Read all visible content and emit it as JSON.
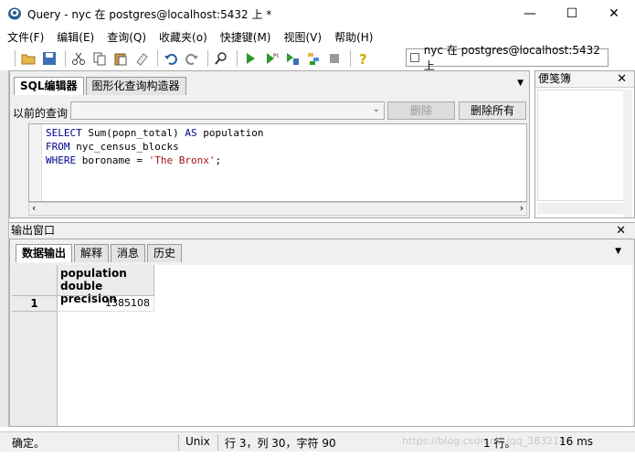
{
  "window": {
    "title": "Query - nyc 在  postgres@localhost:5432 上 *"
  },
  "window_buttons": {
    "minimize": "—",
    "maximize": "☐",
    "close": "✕"
  },
  "menu": [
    "文件(F)",
    "编辑(E)",
    "查询(Q)",
    "收藏夹(o)",
    "快捷键(M)",
    "视图(V)",
    "帮助(H)"
  ],
  "toolbar": {
    "connection": "nyc 在  postgres@localhost:5432 上"
  },
  "editor": {
    "tabs": [
      "SQL编辑器",
      "图形化查询构造器"
    ],
    "previous_label": "以前的查询",
    "delete_label": "删除",
    "delete_all_label": "删除所有",
    "code": {
      "line1": {
        "kw1": "SELECT",
        "t1": " Sum(popn_total) ",
        "kw2": "AS",
        "t2": " population"
      },
      "line2": {
        "kw1": "FROM",
        "t1": " nyc_census_blocks"
      },
      "line3": {
        "kw1": "WHERE",
        "t1": " boroname = ",
        "str": "'The Bronx'",
        "t2": ";"
      }
    }
  },
  "scratch": {
    "title": "便笺簿",
    "close": "✕"
  },
  "output": {
    "title": "输出窗口",
    "close": "✕",
    "tabs": [
      "数据输出",
      "解释",
      "消息",
      "历史"
    ],
    "column": {
      "name": "population",
      "type": "double precision"
    },
    "rows": [
      {
        "num": "1",
        "value": "1385108"
      }
    ]
  },
  "status": {
    "ready": "确定。",
    "eol": "Unix",
    "position": "行 3，列 30，字符 90",
    "watermark": "https://blog.csdn.net/qq_3832140",
    "rows": "1 行。",
    "time": "16 ms"
  },
  "colors": {
    "keyword": "#00008b",
    "string": "#a31515",
    "accent": "#1e6fd9"
  }
}
